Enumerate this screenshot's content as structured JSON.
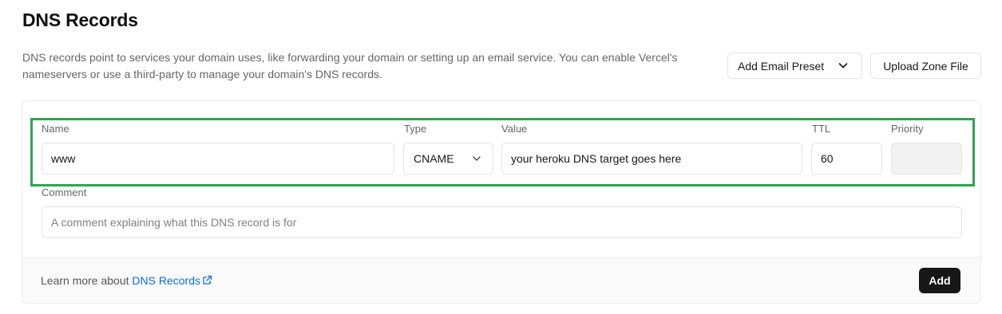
{
  "header": {
    "title": "DNS Records",
    "description": "DNS records point to services your domain uses, like forwarding your domain or setting up an email service. You can enable Vercel's nameservers or use a third-party to manage your domain's DNS records."
  },
  "actions": {
    "email_preset_label": "Add Email Preset",
    "upload_zone_label": "Upload Zone File"
  },
  "form": {
    "name": {
      "label": "Name",
      "value": "www"
    },
    "type": {
      "label": "Type",
      "value": "CNAME"
    },
    "value": {
      "label": "Value",
      "value": "your heroku DNS target goes here"
    },
    "ttl": {
      "label": "TTL",
      "value": "60"
    },
    "priority": {
      "label": "Priority",
      "value": ""
    },
    "comment": {
      "label": "Comment",
      "placeholder": "A comment explaining what this DNS record is for"
    }
  },
  "footer": {
    "learn_prefix": "Learn more about",
    "learn_link": "DNS Records",
    "add_label": "Add"
  },
  "colors": {
    "highlight": "#2ea44f",
    "link": "#0a6ee0",
    "primary_button": "#171717"
  },
  "icons": {
    "dropdown": "chevron-down-icon",
    "external_link": "external-link-icon"
  }
}
